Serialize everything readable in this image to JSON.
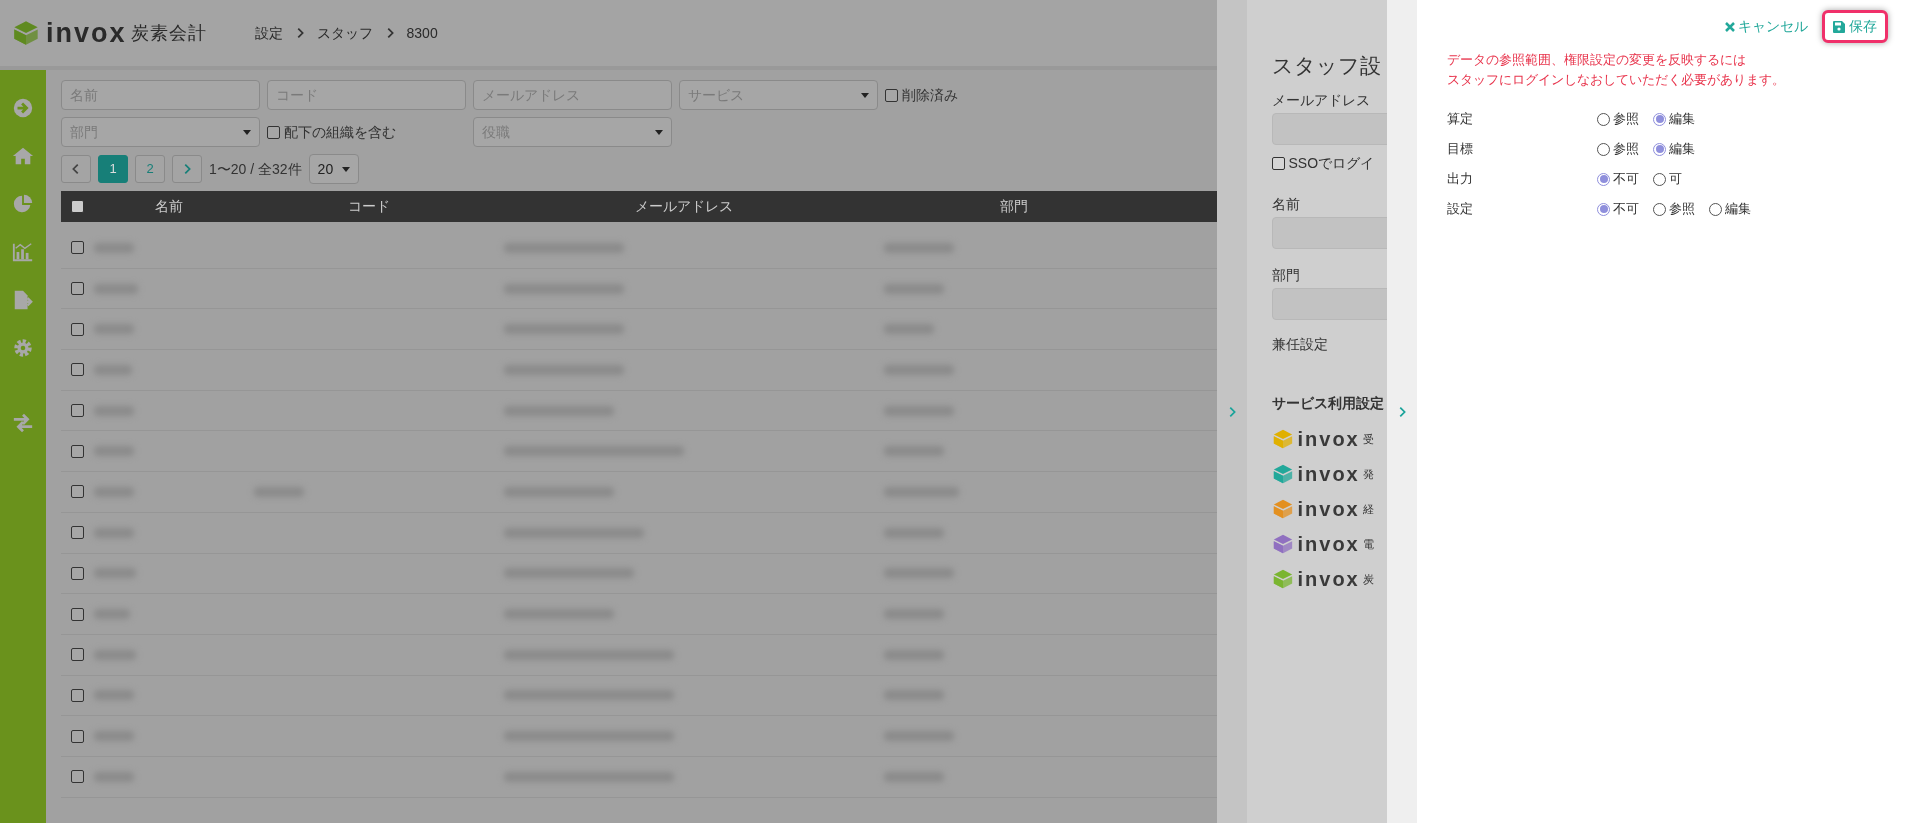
{
  "header": {
    "logo_word": "invox",
    "logo_product": "炭素会計",
    "breadcrumb": [
      "設定",
      "スタッフ",
      "8300"
    ]
  },
  "sidebar": {
    "items": [
      {
        "kind": "arrow"
      },
      {
        "kind": "home"
      },
      {
        "kind": "pie"
      },
      {
        "kind": "bars"
      },
      {
        "kind": "export"
      },
      {
        "kind": "gear"
      },
      {
        "kind": "swap"
      }
    ]
  },
  "filters": {
    "name": {
      "placeholder": "名前"
    },
    "code": {
      "placeholder": "コード"
    },
    "email": {
      "placeholder": "メールアドレス"
    },
    "service": {
      "placeholder": "サービス"
    },
    "deleted": {
      "label": "削除済み",
      "checked": false
    },
    "department": {
      "placeholder": "部門"
    },
    "include_sub": {
      "label": "配下の組織を含む",
      "checked": false
    },
    "position": {
      "placeholder": "役職"
    }
  },
  "pagination": {
    "pages": [
      {
        "label": "1",
        "selected": true
      },
      {
        "label": "2",
        "selected": false
      }
    ],
    "summary": "1〜20 / 全32件",
    "page_size": "20"
  },
  "table": {
    "columns": [
      "名前",
      "コード",
      "メールアドレス",
      "部門"
    ],
    "header_checked": false,
    "rows": [
      {
        "checked": false
      },
      {
        "checked": false
      },
      {
        "checked": false
      },
      {
        "checked": false
      },
      {
        "checked": false
      },
      {
        "checked": false
      },
      {
        "checked": false
      },
      {
        "checked": false
      },
      {
        "checked": false
      },
      {
        "checked": false
      },
      {
        "checked": false
      },
      {
        "checked": false
      },
      {
        "checked": false
      },
      {
        "checked": false
      }
    ]
  },
  "staff_panel": {
    "title": "スタッフ設",
    "email_label": "メールアドレス",
    "sso": {
      "label": "SSOでログイ",
      "checked": false
    },
    "name_label": "名前",
    "department_label": "部門",
    "concurrent_label": "兼任設定",
    "services_title": "サービス利用設定",
    "services": [
      {
        "word": "invox",
        "suffix": "受",
        "color": "#e0b000"
      },
      {
        "word": "invox",
        "suffix": "発",
        "color": "#22a89a"
      },
      {
        "word": "invox",
        "suffix": "経",
        "color": "#e39020"
      },
      {
        "word": "invox",
        "suffix": "電",
        "color": "#9070c0"
      },
      {
        "word": "invox",
        "suffix": "炭",
        "color": "#7ab530"
      }
    ]
  },
  "permission_panel": {
    "cancel": "キャンセル",
    "save": "保存",
    "notice": [
      "データの参照範囲、権限設定の変更を反映するには",
      "スタッフにログインしなおしていただく必要があります。"
    ],
    "permissions": [
      {
        "label": "算定",
        "options": [
          {
            "label": "参照",
            "selected": false
          },
          {
            "label": "編集",
            "selected": true
          }
        ]
      },
      {
        "label": "目標",
        "options": [
          {
            "label": "参照",
            "selected": false
          },
          {
            "label": "編集",
            "selected": true
          }
        ]
      },
      {
        "label": "出力",
        "options": [
          {
            "label": "不可",
            "selected": true
          },
          {
            "label": "可",
            "selected": false
          }
        ]
      },
      {
        "label": "設定",
        "options": [
          {
            "label": "不可",
            "selected": true
          },
          {
            "label": "参照",
            "selected": false
          },
          {
            "label": "編集",
            "selected": false
          }
        ]
      }
    ]
  }
}
